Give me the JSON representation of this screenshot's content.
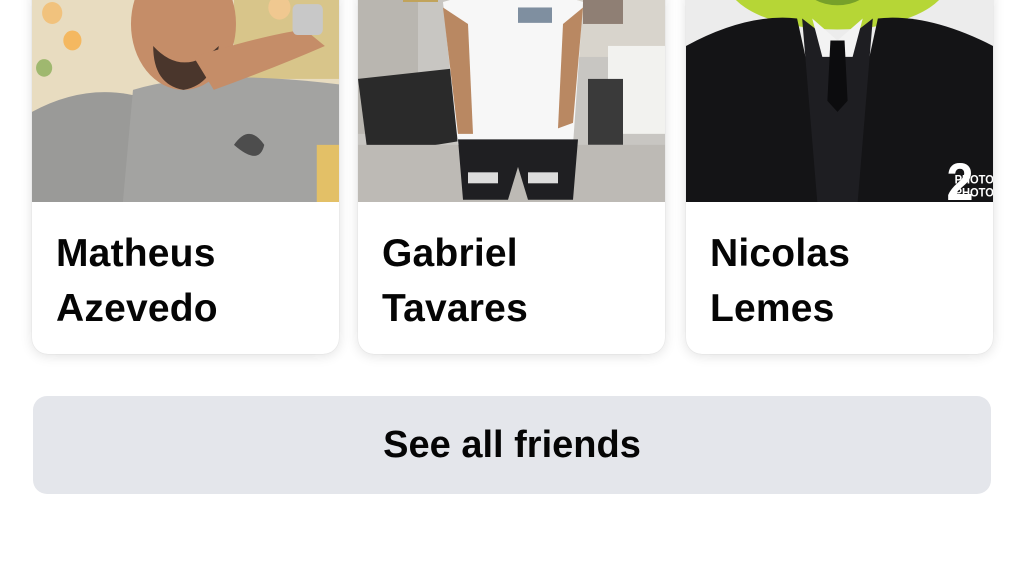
{
  "friends": [
    {
      "first_name": "Matheus",
      "last_name": "Azevedo"
    },
    {
      "first_name": "Gabriel",
      "last_name": "Tavares"
    },
    {
      "first_name": "Nicolas",
      "last_name": "Lemes"
    }
  ],
  "see_all_button": {
    "label": "See all friends"
  },
  "photo_watermark": {
    "number": "2",
    "text": "PHOTO"
  },
  "colors": {
    "name_text": "#050505",
    "button_background": "#e4e6eb",
    "card_background": "#ffffff"
  }
}
